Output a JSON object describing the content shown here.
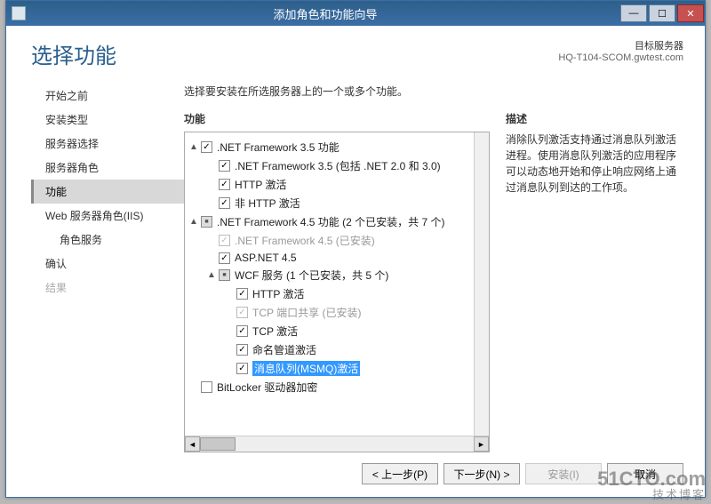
{
  "titlebar": {
    "title": "添加角色和功能向导"
  },
  "header": {
    "title": "选择功能",
    "target_label": "目标服务器",
    "target_value": "HQ-T104-SCOM.gwtest.com"
  },
  "sidebar": {
    "items": [
      {
        "label": "开始之前",
        "state": "done"
      },
      {
        "label": "安装类型",
        "state": "done"
      },
      {
        "label": "服务器选择",
        "state": "done"
      },
      {
        "label": "服务器角色",
        "state": "done"
      },
      {
        "label": "功能",
        "state": "active"
      },
      {
        "label": "Web 服务器角色(IIS)",
        "state": "done"
      },
      {
        "label": "角色服务",
        "state": "done",
        "sub": true
      },
      {
        "label": "确认",
        "state": "done"
      },
      {
        "label": "结果",
        "state": "disabled"
      }
    ]
  },
  "main": {
    "instruction": "选择要安装在所选服务器上的一个或多个功能。",
    "features_label": "功能",
    "desc_label": "描述",
    "desc_text": "消除队列激活支持通过消息队列激活进程。使用消息队列激活的应用程序可以动态地开始和停止响应网络上通过消息队列到达的工作项。",
    "tree": [
      {
        "indent": 0,
        "expander": "▲",
        "check": "checked",
        "text": ".NET Framework 3.5 功能"
      },
      {
        "indent": 1,
        "expander": "",
        "check": "checked",
        "text": ".NET Framework 3.5 (包括 .NET 2.0 和 3.0)"
      },
      {
        "indent": 1,
        "expander": "",
        "check": "checked",
        "text": "HTTP 激活"
      },
      {
        "indent": 1,
        "expander": "",
        "check": "checked",
        "text": "非 HTTP 激活"
      },
      {
        "indent": 0,
        "expander": "▲",
        "check": "partial",
        "text": ".NET Framework 4.5 功能 (2 个已安装，共 7 个)"
      },
      {
        "indent": 1,
        "expander": "",
        "check": "checked",
        "disabled": true,
        "text": ".NET Framework 4.5 (已安装)"
      },
      {
        "indent": 1,
        "expander": "",
        "check": "checked",
        "text": "ASP.NET 4.5"
      },
      {
        "indent": 1,
        "expander": "▲",
        "check": "partial",
        "text": "WCF 服务 (1 个已安装，共 5 个)"
      },
      {
        "indent": 2,
        "expander": "",
        "check": "checked",
        "text": "HTTP 激活"
      },
      {
        "indent": 2,
        "expander": "",
        "check": "checked",
        "disabled": true,
        "text": "TCP 端口共享 (已安装)"
      },
      {
        "indent": 2,
        "expander": "",
        "check": "checked",
        "text": "TCP 激活"
      },
      {
        "indent": 2,
        "expander": "",
        "check": "checked",
        "text": "命名管道激活"
      },
      {
        "indent": 2,
        "expander": "",
        "check": "checked",
        "selected": true,
        "text": "消息队列(MSMQ)激活"
      },
      {
        "indent": 0,
        "expander": "",
        "check": "unchecked",
        "text": "BitLocker 驱动器加密"
      }
    ]
  },
  "footer": {
    "prev": "< 上一步(P)",
    "next": "下一步(N) >",
    "install": "安装(I)",
    "cancel": "取消"
  },
  "watermark": {
    "line1": "51CTO.com",
    "line2": "技术博客"
  }
}
